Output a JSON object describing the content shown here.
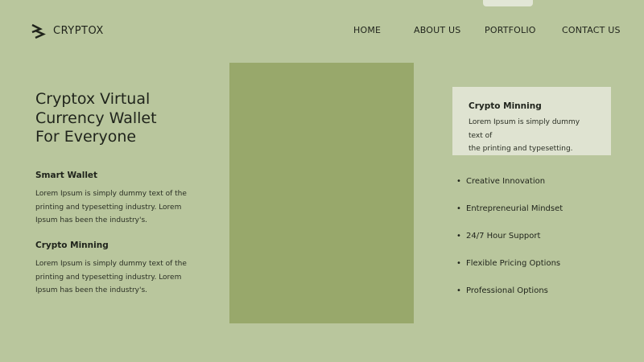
{
  "brand": {
    "name": "CRYPTOX",
    "logo_icon": "double-chevron-logo-icon"
  },
  "nav": {
    "items": [
      "HOME",
      "ABOUT US",
      "PORTFOLIO",
      "CONTACT US"
    ]
  },
  "hero": {
    "title_lines": [
      "Cryptox Virtual",
      "Currency Wallet",
      "For Everyone"
    ]
  },
  "features": [
    {
      "title": "Smart Wallet",
      "text_lines": [
        "Lorem Ipsum is simply dummy text of the",
        "printing and typesetting industry.  Lorem",
        "Ipsum has been the industry's."
      ]
    },
    {
      "title": "Crypto Minning",
      "text_lines": [
        "Lorem Ipsum is simply dummy text of the",
        "printing and typesetting industry.  Lorem",
        "Ipsum has been the industry's."
      ]
    }
  ],
  "card": {
    "title": "Crypto Minning",
    "text_lines": [
      "Lorem Ipsum is simply dummy text of",
      "the printing and typesetting."
    ]
  },
  "list": {
    "bullet": "•",
    "items": [
      "Creative Innovation",
      "Entrepreneurial Mindset",
      "24/7 Hour Support",
      "Flexible Pricing Options",
      "Professional Options"
    ]
  },
  "colors": {
    "background": "#b9c69d",
    "image_placeholder": "#98a86b",
    "card": "#dfe3d1",
    "text": "#1f231b"
  }
}
